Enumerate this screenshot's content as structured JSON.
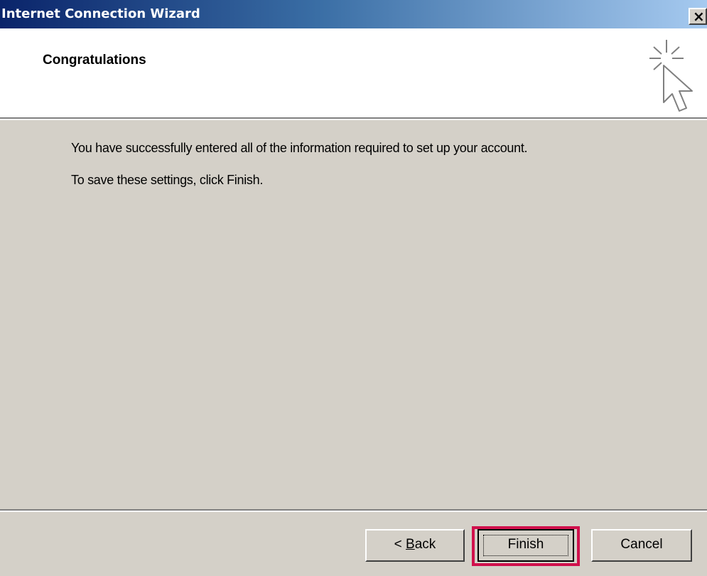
{
  "window": {
    "title": "Internet Connection Wizard",
    "close_label": "×"
  },
  "header": {
    "title": "Congratulations",
    "icon": "wizard-cursor-sparkle-icon"
  },
  "body": {
    "line1": "You have successfully entered all of the information required to set up your account.",
    "line2": "To save these settings, click Finish."
  },
  "buttons": {
    "back_prefix": "< ",
    "back_mnemonic": "B",
    "back_rest": "ack",
    "finish": "Finish",
    "cancel": "Cancel"
  },
  "colors": {
    "titlebar_start": "#0a246a",
    "titlebar_end": "#a6caf0",
    "dialog_bg": "#d4d0c8",
    "highlight": "#d0104c"
  }
}
